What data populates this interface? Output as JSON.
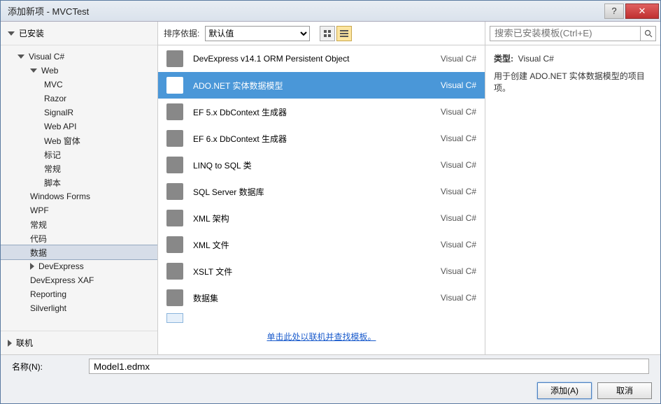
{
  "titlebar": {
    "title": "添加新项 - MVCTest"
  },
  "sidebar": {
    "header": "已安装",
    "footer": "联机",
    "tree": [
      {
        "label": "Visual C#",
        "level": 1,
        "arrow": "open"
      },
      {
        "label": "Web",
        "level": 2,
        "arrow": "open"
      },
      {
        "label": "MVC",
        "level": 3
      },
      {
        "label": "Razor",
        "level": 3
      },
      {
        "label": "SignalR",
        "level": 3
      },
      {
        "label": "Web API",
        "level": 3
      },
      {
        "label": "Web 窗体",
        "level": 3
      },
      {
        "label": "标记",
        "level": 3
      },
      {
        "label": "常规",
        "level": 3
      },
      {
        "label": "脚本",
        "level": 3
      },
      {
        "label": "Windows Forms",
        "level": 2
      },
      {
        "label": "WPF",
        "level": 2
      },
      {
        "label": "常规",
        "level": 2
      },
      {
        "label": "代码",
        "level": 2
      },
      {
        "label": "数据",
        "level": 2,
        "selected": true
      },
      {
        "label": "DevExpress",
        "level": 2,
        "arrow": "right"
      },
      {
        "label": "DevExpress XAF",
        "level": 2
      },
      {
        "label": "Reporting",
        "level": 2
      },
      {
        "label": "Silverlight",
        "level": 2
      }
    ]
  },
  "center": {
    "sort_label": "排序依据:",
    "sort_value": "默认值",
    "items": [
      {
        "label": "DevExpress v14.1 ORM Persistent Object",
        "lang": "Visual C#"
      },
      {
        "label": "ADO.NET 实体数据模型",
        "lang": "Visual C#",
        "selected": true
      },
      {
        "label": "EF 5.x DbContext 生成器",
        "lang": "Visual C#"
      },
      {
        "label": "EF 6.x DbContext 生成器",
        "lang": "Visual C#"
      },
      {
        "label": "LINQ to SQL 类",
        "lang": "Visual C#"
      },
      {
        "label": "SQL Server 数据库",
        "lang": "Visual C#"
      },
      {
        "label": "XML 架构",
        "lang": "Visual C#"
      },
      {
        "label": "XML 文件",
        "lang": "Visual C#"
      },
      {
        "label": "XSLT 文件",
        "lang": "Visual C#"
      },
      {
        "label": "数据集",
        "lang": "Visual C#"
      }
    ],
    "online_link": "单击此处以联机并查找模板。"
  },
  "rightpane": {
    "search_placeholder": "搜索已安装模板(Ctrl+E)",
    "type_label": "类型:",
    "type_value": "Visual C#",
    "description": "用于创建 ADO.NET 实体数据模型的项目项。"
  },
  "footer": {
    "name_label": "名称(N):",
    "name_value": "Model1.edmx",
    "add_btn": "添加(A)",
    "cancel_btn": "取消"
  }
}
